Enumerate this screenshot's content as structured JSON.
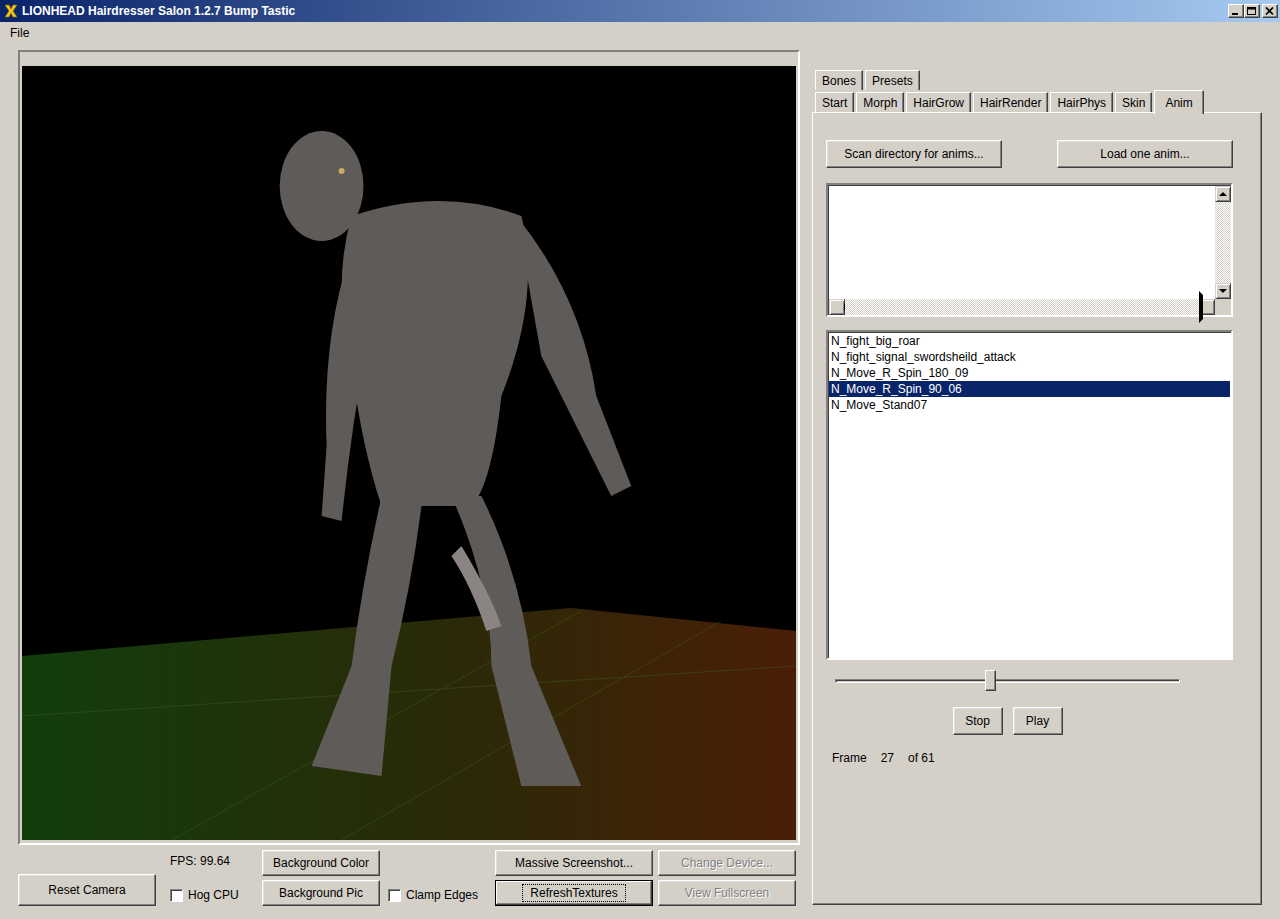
{
  "window": {
    "title": "LIONHEAD Hairdresser Salon 1.2.7 Bump Tastic",
    "controls": [
      {
        "kind": "minimize"
      },
      {
        "kind": "maximize"
      },
      {
        "kind": "close"
      }
    ]
  },
  "menu": [
    {
      "label": "File"
    }
  ],
  "bottom_controls": {
    "reset_button": "Reset Camera",
    "fps": "FPS: 99.64",
    "checkboxes": [
      {
        "label": "Hog CPU",
        "checked": false
      },
      {
        "label": "Clamp Edges",
        "checked": false
      }
    ],
    "buttons": [
      {
        "label": "Background Color",
        "disabled": false,
        "focused": false
      },
      {
        "label": "Background Pic",
        "disabled": false,
        "focused": false
      },
      {
        "label": "Massive Screenshot...",
        "disabled": false,
        "focused": false
      },
      {
        "label": "RefreshTextures",
        "disabled": false,
        "focused": true
      },
      {
        "label": "Change Device...",
        "disabled": true,
        "focused": false
      },
      {
        "label": "View Fullscreen",
        "disabled": true,
        "focused": false
      }
    ]
  },
  "tabs": {
    "rows": [
      {
        "tabs": [
          {
            "label": "Bones",
            "selected": false
          },
          {
            "label": "Presets",
            "selected": false
          }
        ]
      },
      {
        "tabs": [
          {
            "label": "Start",
            "selected": false
          },
          {
            "label": "Morph",
            "selected": false
          },
          {
            "label": "HairGrow",
            "selected": false
          },
          {
            "label": "HairRender",
            "selected": false
          },
          {
            "label": "HairPhys",
            "selected": false
          },
          {
            "label": "Skin",
            "selected": false
          },
          {
            "label": "Anim",
            "selected": true
          }
        ]
      }
    ]
  },
  "anim_panel": {
    "buttons": [
      "Scan directory for anims...",
      "Load one anim..."
    ],
    "anim_list": [
      {
        "name": "N_fight_big_roar",
        "selected": false
      },
      {
        "name": "N_fight_signal_swordsheild_attack",
        "selected": false
      },
      {
        "name": "N_Move_R_Spin_180_09",
        "selected": false
      },
      {
        "name": "N_Move_R_Spin_90_06",
        "selected": true
      },
      {
        "name": "N_Move_Stand07",
        "selected": false
      }
    ],
    "slider": {
      "level": 0.45
    },
    "playback_buttons": [
      "Stop",
      "Play"
    ],
    "frame": {
      "label": "Frame",
      "current": "27",
      "total": "of 61"
    }
  }
}
